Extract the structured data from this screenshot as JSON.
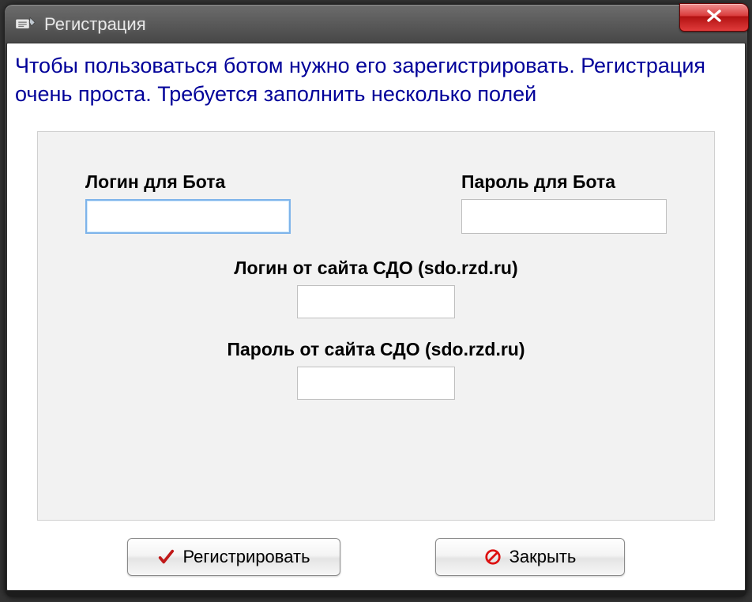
{
  "window": {
    "title": "Регистрация"
  },
  "intro": "Чтобы пользоваться ботом нужно его зарегистрировать. Регистрация очень проста. Требуется заполнить несколько полей",
  "fields": {
    "bot_login": {
      "label": "Логин для Бота",
      "value": ""
    },
    "bot_password": {
      "label": "Пароль для Бота",
      "value": ""
    },
    "sdo_login": {
      "label": "Логин от сайта СДО (sdo.rzd.ru)",
      "value": ""
    },
    "sdo_password": {
      "label": "Пароль от сайта СДО (sdo.rzd.ru)",
      "value": ""
    }
  },
  "buttons": {
    "register": "Регистрировать",
    "close": "Закрыть"
  }
}
